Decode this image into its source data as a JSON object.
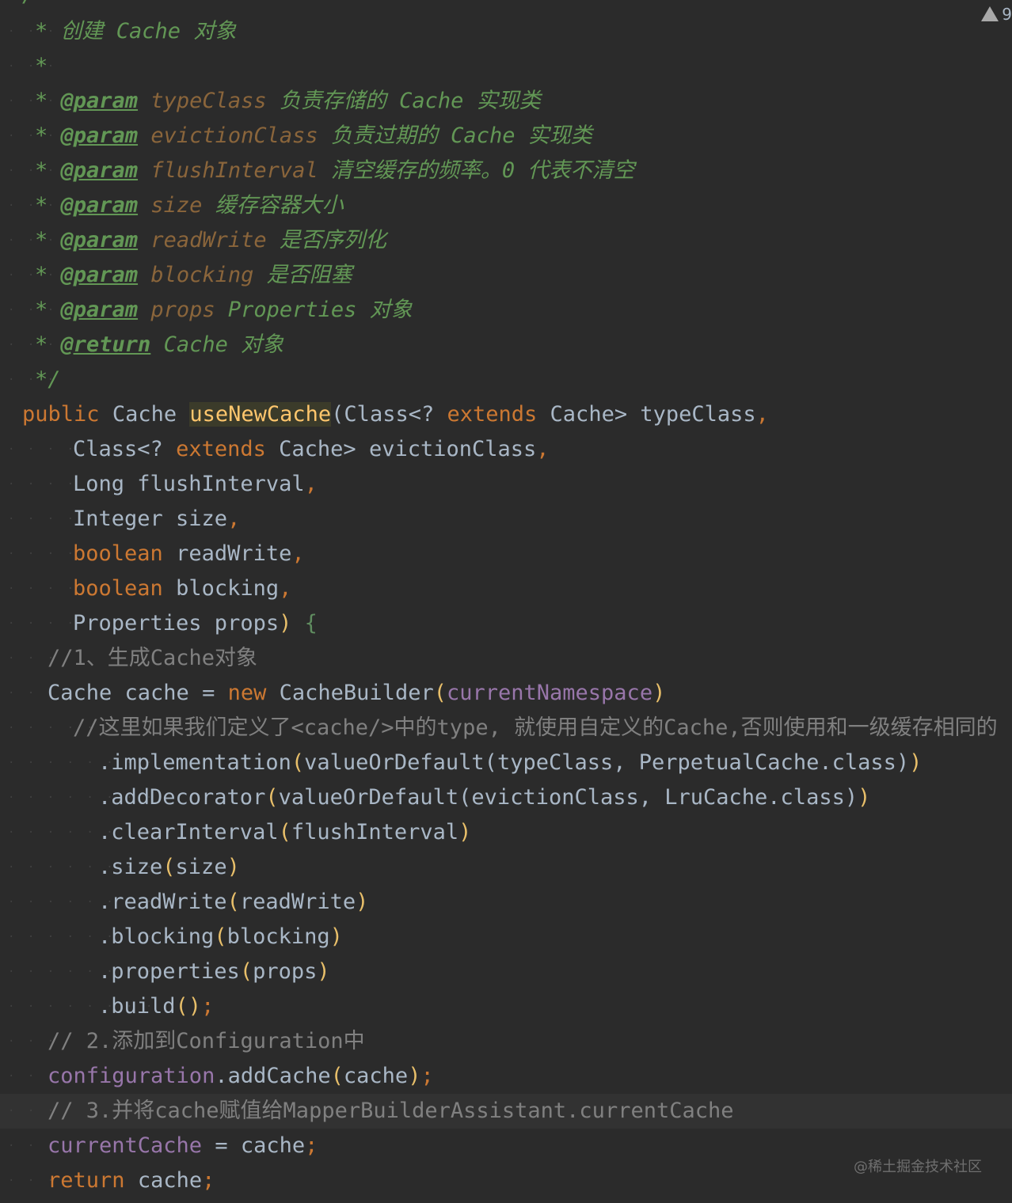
{
  "editor": {
    "warning_count": "9",
    "top_fragment": "/**",
    "doc": {
      "line1": {
        "star": "*",
        "text": "创建 Cache 对象"
      },
      "line2": {
        "star": "*"
      },
      "params": [
        {
          "tag": "@param",
          "name": "typeClass",
          "desc": "负责存储的 Cache 实现类"
        },
        {
          "tag": "@param",
          "name": "evictionClass",
          "desc": "负责过期的 Cache 实现类"
        },
        {
          "tag": "@param",
          "name": "flushInterval",
          "desc": "清空缓存的频率。0 代表不清空"
        },
        {
          "tag": "@param",
          "name": "size",
          "desc": "缓存容器大小"
        },
        {
          "tag": "@param",
          "name": "readWrite",
          "desc": "是否序列化"
        },
        {
          "tag": "@param",
          "name": "blocking",
          "desc": "是否阻塞"
        },
        {
          "tag": "@param",
          "name": "props",
          "desc": "Properties 对象"
        }
      ],
      "return": {
        "tag": "@return",
        "desc": "Cache 对象"
      },
      "end": "*/"
    },
    "signature": {
      "public": "public",
      "ret_type": "Cache",
      "method": "useNewCache",
      "p1_a": "(Class<?",
      "p1_ext": "extends",
      "p1_b": "Cache>",
      "p1_name": "typeClass",
      "p2_a": "Class<?",
      "p2_ext": "extends",
      "p2_b": "Cache>",
      "p2_name": "evictionClass",
      "p3": "Long flushInterval",
      "p4": "Integer size",
      "p5_type": "boolean",
      "p5_name": "readWrite",
      "p6_type": "boolean",
      "p6_name": "blocking",
      "p7": "Properties props",
      "comma": ",",
      "close_paren": ")",
      "open_brace": "{"
    },
    "body": {
      "cmt1": "//1、生成Cache对象",
      "decl_type": "Cache cache =",
      "new_kw": "new",
      "builder": "CacheBuilder",
      "ns_field": "currentNamespace",
      "cmt2": "//这里如果我们定义了<cache/>中的type, 就使用自定义的Cache,否则使用和一级缓存相同的",
      "chain": [
        {
          "method": ".implementation",
          "args": "valueOrDefault(typeClass, PerpetualCache.class)"
        },
        {
          "method": ".addDecorator",
          "args": "valueOrDefault(evictionClass, LruCache.class)"
        },
        {
          "method": ".clearInterval",
          "args": "flushInterval"
        },
        {
          "method": ".size",
          "args": "size"
        },
        {
          "method": ".readWrite",
          "args": "readWrite"
        },
        {
          "method": ".blocking",
          "args": "blocking"
        },
        {
          "method": ".properties",
          "args": "props"
        },
        {
          "method": ".build",
          "args": ""
        }
      ],
      "semicolon": ";",
      "cmt3": "// 2.添加到Configuration中",
      "config_field": "configuration",
      "add_cache": ".addCache",
      "add_cache_arg": "cache",
      "cmt4": "// 3.并将cache赋值给MapperBuilderAssistant.currentCache",
      "cur_field": "currentCache",
      "assign_rest": "= cache",
      "return_kw": "return",
      "return_val": "cache"
    },
    "watermark": "@稀土掘金技术社区"
  }
}
